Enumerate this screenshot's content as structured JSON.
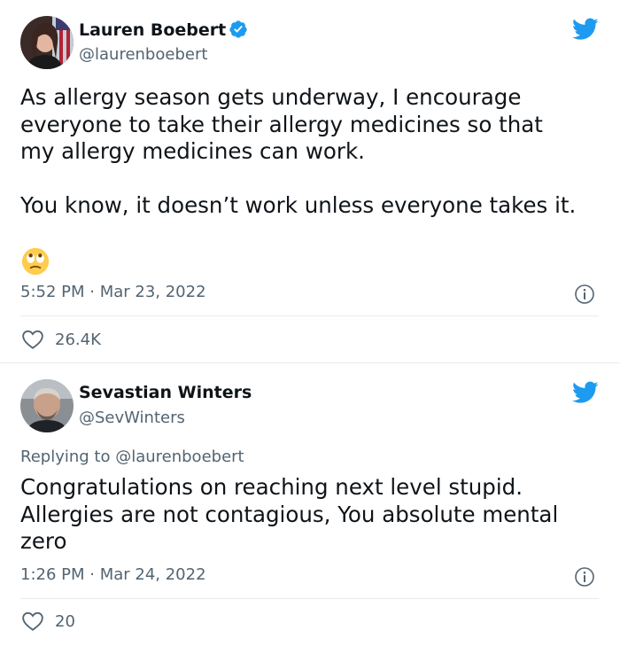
{
  "tweet1": {
    "author_name": "Lauren Boebert",
    "handle": "@laurenboebert",
    "verified": true,
    "text_lines": [
      "As allergy season gets underway, I encourage",
      "everyone to take their allergy medicines so that",
      "my allergy medicines can work."
    ],
    "text_line_2": "You know, it doesn’t work unless everyone takes it.",
    "emoji": "face-with-rolling-eyes",
    "timestamp": "5:52 PM · Mar 23, 2022",
    "likes": "26.4K"
  },
  "tweet2": {
    "author_name": "Sevastian Winters",
    "handle": "@SevWinters",
    "replying_prefix": "Replying to ",
    "replying_to": "@laurenboebert",
    "text_lines": [
      "Congratulations on reaching next level stupid.",
      "Allergies are not contagious, You absolute mental",
      "zero"
    ],
    "timestamp": "1:26 PM · Mar 24, 2022",
    "likes": "20"
  },
  "colors": {
    "twitter_blue": "#1d9bf0",
    "secondary_text": "#536471",
    "primary_text": "#0f1419",
    "divider": "#e6ecf0"
  },
  "icons": [
    "twitter-bird-icon",
    "verified-badge-icon",
    "heart-icon",
    "info-icon",
    "rolling-eyes-emoji"
  ]
}
